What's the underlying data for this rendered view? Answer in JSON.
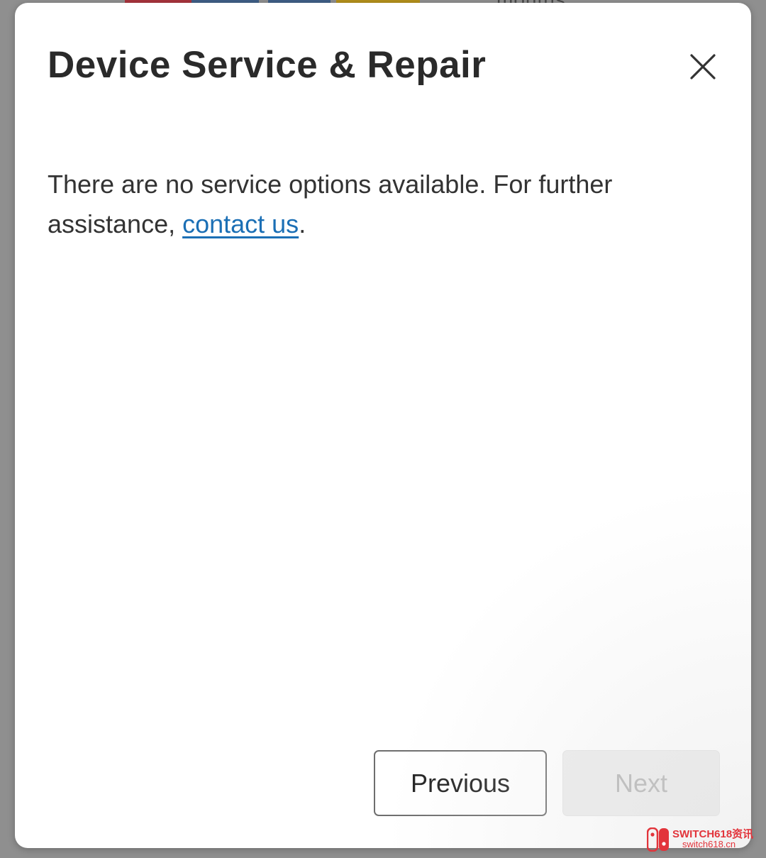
{
  "background": {
    "partial_text": "months"
  },
  "dialog": {
    "title": "Device Service & Repair",
    "message_prefix": "There are no service options available. For further assistance, ",
    "link_label": "contact us",
    "message_suffix": ".",
    "close_icon": "close-icon",
    "previous_label": "Previous",
    "next_label": "Next"
  },
  "watermark": {
    "text": "SWITCH618资讯",
    "sub": "switch618.cn"
  },
  "colors": {
    "link": "#1b6fb5",
    "title_text": "#2a2a2a",
    "body_text": "#333333",
    "disabled_button_bg": "#ededed",
    "disabled_button_text": "#b3b3b3",
    "watermark": "#e2343b"
  }
}
